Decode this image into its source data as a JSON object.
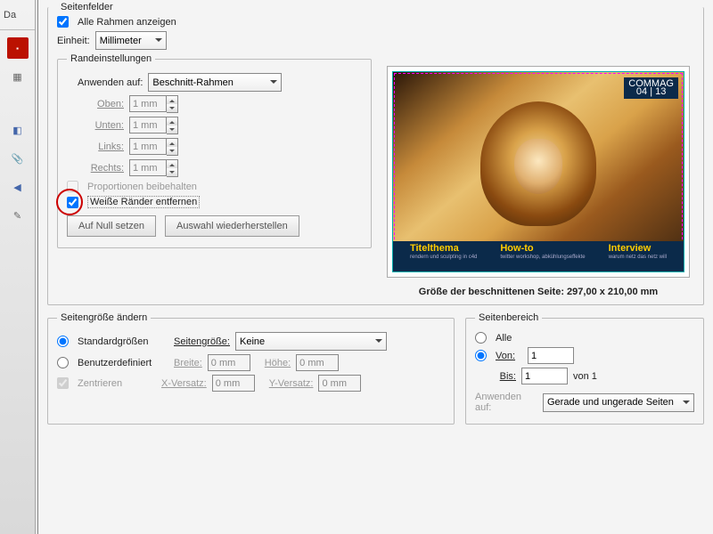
{
  "seitenfelder": {
    "legend": "Seitenfelder",
    "alle_rahmen": "Alle Rahmen anzeigen",
    "einheit_label": "Einheit:",
    "einheit_value": "Millimeter"
  },
  "rand": {
    "legend": "Randeinstellungen",
    "anwenden_label": "Anwenden auf:",
    "anwenden_value": "Beschnitt-Rahmen",
    "oben_label": "Oben:",
    "oben_value": "1 mm",
    "unten_label": "Unten:",
    "unten_value": "1 mm",
    "links_label": "Links:",
    "links_value": "1 mm",
    "rechts_label": "Rechts:",
    "rechts_value": "1 mm",
    "prop_label": "Proportionen beibehalten",
    "weisse_label": "Weiße Ränder entfernen",
    "null_btn": "Auf Null setzen",
    "restore_btn": "Auswahl wiederherstellen"
  },
  "preview": {
    "badge_top": "COMMAG",
    "badge_bot": "04 | 13",
    "s1t": "Titelthema",
    "s1b": "rendern und sculpting in c4d",
    "s2t": "How-to",
    "s2b": "twitter workshop, abkühlungseffekte",
    "s3t": "Interview",
    "s3b": "warum netz das netz will",
    "size": "Größe der beschnittenen Seite: 297,00 x 210,00 mm"
  },
  "pagesize": {
    "legend": "Seitengröße ändern",
    "std_label": "Standardgrößen",
    "seiteng_label": "Seitengröße:",
    "seiteng_value": "Keine",
    "ben_label": "Benutzerdefiniert",
    "breite_label": "Breite:",
    "breite_value": "0 mm",
    "hoehe_label": "Höhe:",
    "hoehe_value": "0 mm",
    "zentr_label": "Zentrieren",
    "xv_label": "X-Versatz:",
    "xv_value": "0 mm",
    "yv_label": "Y-Versatz:",
    "yv_value": "0 mm"
  },
  "range": {
    "legend": "Seitenbereich",
    "alle": "Alle",
    "von_label": "Von:",
    "von_value": "1",
    "bis_label": "Bis:",
    "bis_value": "1",
    "von_suffix": "von 1",
    "anwenden_label": "Anwenden auf:",
    "anwenden_value": "Gerade und ungerade Seiten"
  }
}
